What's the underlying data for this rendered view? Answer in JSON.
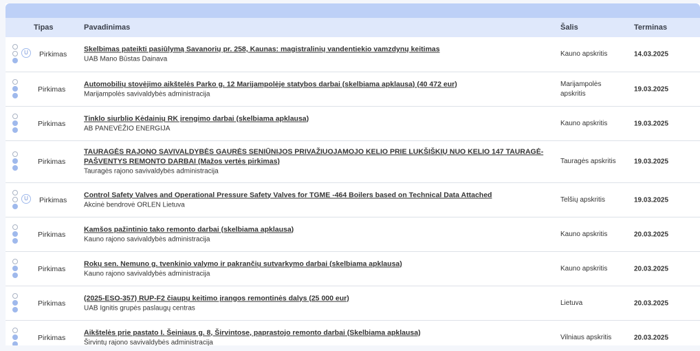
{
  "table": {
    "headers": {
      "type": "Tipas",
      "name": "Pavadinimas",
      "country": "Šalis",
      "term": "Terminas"
    },
    "rows": [
      {
        "icon": "u-badge-icon",
        "type": "Pirkimas",
        "title": "Skelbimas pateikti pasiūlymą Savanorių pr. 258, Kaunas: magistralinių vandentiekio vamzdynų keitimas",
        "org": "UAB Mano Būstas Dainava",
        "country": "Kauno apskritis",
        "term": "14.03.2025"
      },
      {
        "icon": "",
        "type": "Pirkimas",
        "title": "Automobilių stovėjimo aikštelės Parko g. 12 Marijampolėje statybos darbai (skelbiama apklausa) (40 472 eur)",
        "org": "Marijampolės savivaldybės administracija",
        "country": "Marijampolės apskritis",
        "term": "19.03.2025"
      },
      {
        "icon": "",
        "type": "Pirkimas",
        "title": "Tinklo siurblio Kėdainių RK įrengimo darbai (skelbiama apklausa)",
        "org": "AB PANEVĖŽIO ENERGIJA",
        "country": "Kauno apskritis",
        "term": "19.03.2025"
      },
      {
        "icon": "",
        "type": "Pirkimas",
        "title": "TAURAGĖS RAJONO SAVIVALDYBĖS GAURĖS SENIŪNIJOS PRIVAŽIUOJAMOJO KELIO PRIE LUKŠIŠKIŲ NUO KELIO 147 TAURAGĖ-PAŠVENTYS REMONTO DARBAI (Mažos vertės pirkimas)",
        "org": "Tauragės rajono savivaldybės administracija",
        "country": "Tauragės apskritis",
        "term": "19.03.2025"
      },
      {
        "icon": "u-badge-icon",
        "type": "Pirkimas",
        "title": "Control Safety Valves and Operational Pressure Safety Valves for TGME -464 Boilers based on Technical Data Attached",
        "org": "Akcinė bendrovė ORLEN Lietuva",
        "country": "Telšių apskritis",
        "term": "19.03.2025"
      },
      {
        "icon": "",
        "type": "Pirkimas",
        "title": "Kamšos pažintinio tako remonto darbai (skelbiama apklausa)",
        "org": "Kauno rajono savivaldybės administracija",
        "country": "Kauno apskritis",
        "term": "20.03.2025"
      },
      {
        "icon": "",
        "type": "Pirkimas",
        "title": "Rokų sen. Nemuno g. tvenkinio valymo ir pakrančių sutvarkymo darbai (skelbiama apklausa)",
        "org": "Kauno rajono savivaldybės administracija",
        "country": "Kauno apskritis",
        "term": "20.03.2025"
      },
      {
        "icon": "",
        "type": "Pirkimas",
        "title": "(2025-ESO-357) RUP-F2 čiaupų keitimo įrangos remontinės dalys (25 000 eur)",
        "org": "UAB Ignitis grupės paslaugų centras",
        "country": "Lietuva",
        "term": "20.03.2025"
      },
      {
        "icon": "",
        "type": "Pirkimas",
        "title": "Aikštelės prie pastato I. Šeiniaus g. 8, Širvintose, paprastojo remonto darbai (Skelbiama apklausa)",
        "org": "Širvintų rajono savivaldybės administracija",
        "country": "Vilniaus apskritis",
        "term": "20.03.2025"
      }
    ]
  }
}
